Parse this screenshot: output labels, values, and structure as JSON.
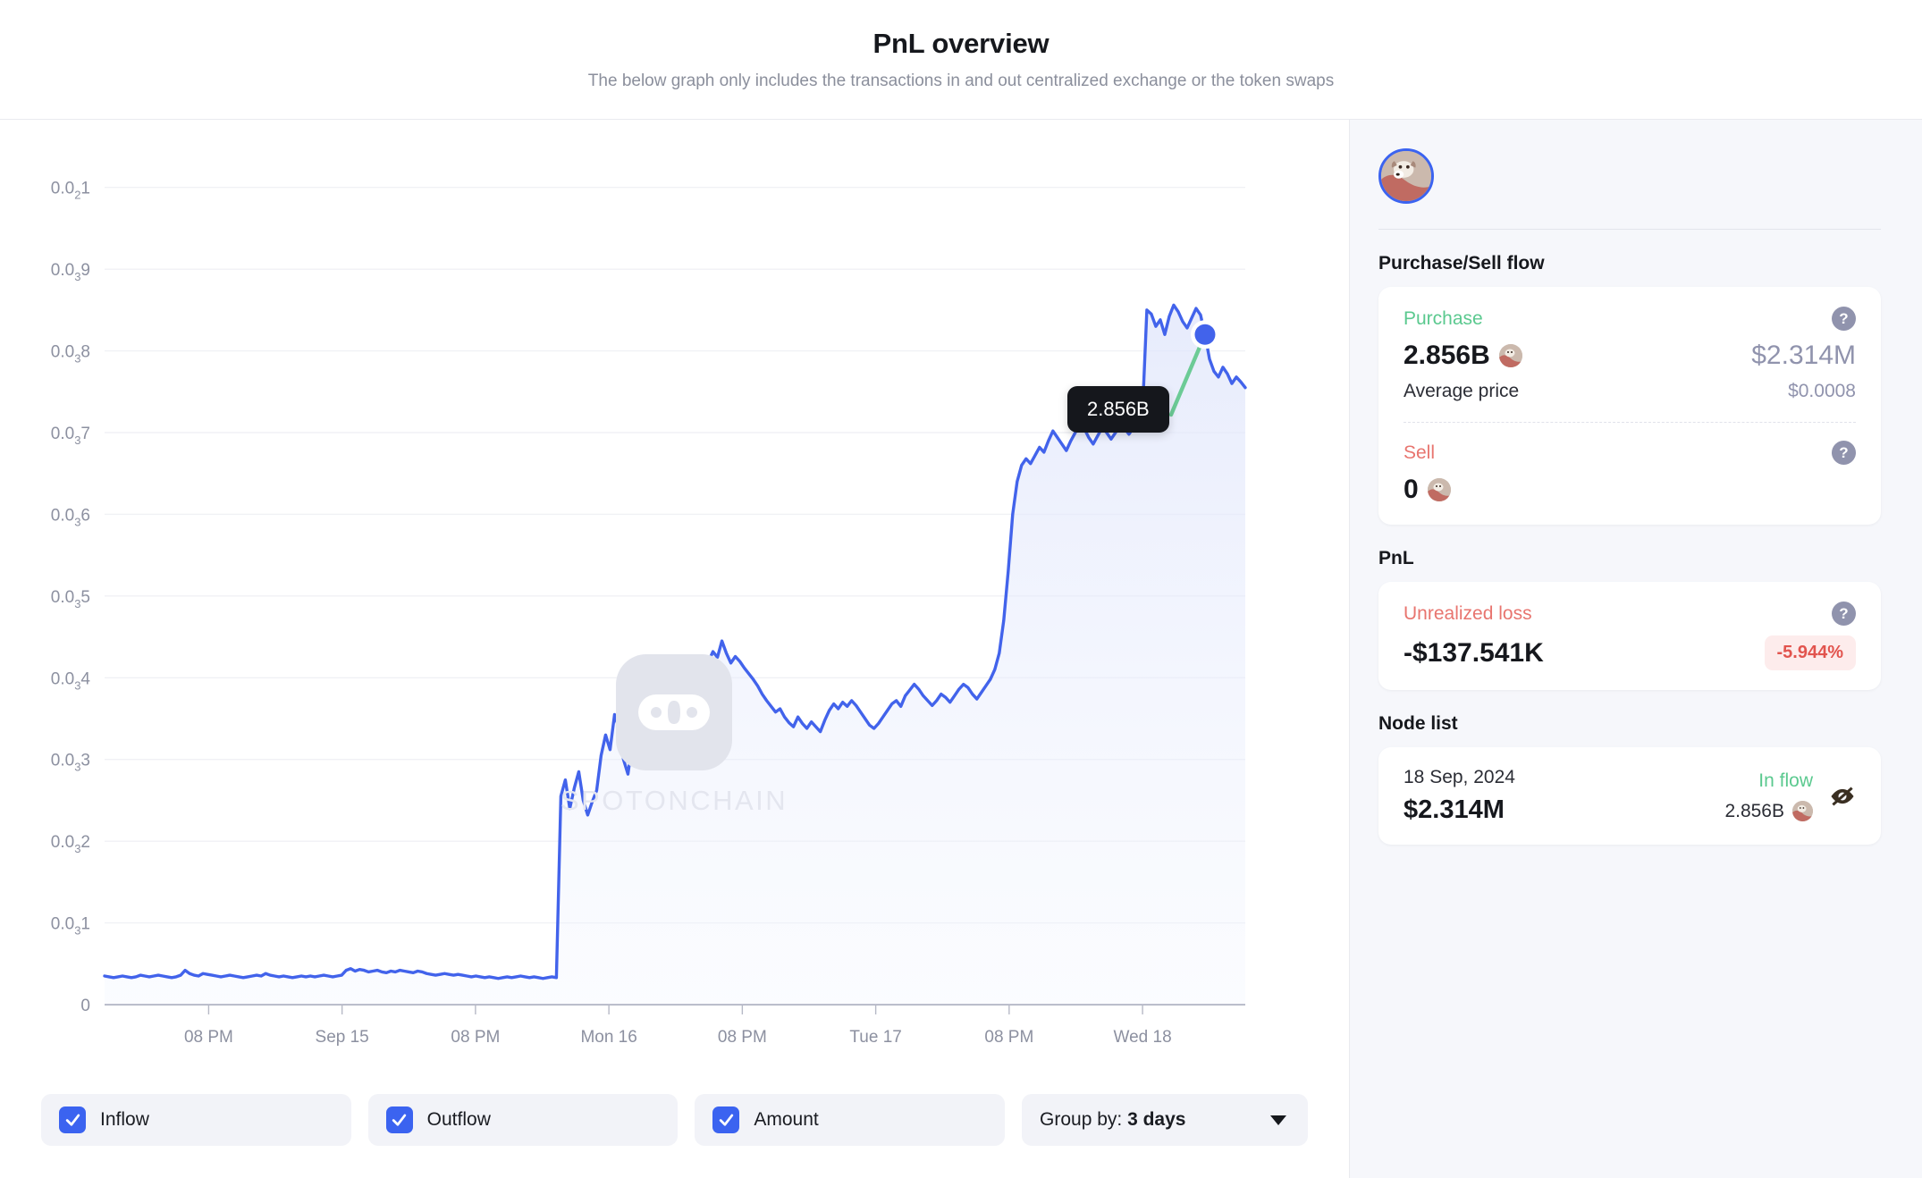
{
  "header": {
    "title": "PnL overview",
    "subtitle": "The below graph only includes the transactions in and out centralized exchange or the token swaps"
  },
  "watermark": {
    "text": "SPOTONCHAIN",
    "logo_icon": "chain-link-icon"
  },
  "chart_tooltip": {
    "value": "2.856B"
  },
  "controls": {
    "inflow": {
      "label": "Inflow",
      "checked": true
    },
    "outflow": {
      "label": "Outflow",
      "checked": true
    },
    "amount": {
      "label": "Amount",
      "checked": true
    },
    "group_by": {
      "prefix": "Group by:",
      "value": "3 days",
      "icon": "chevron-down-icon"
    }
  },
  "sidebar": {
    "avatar_icon": "dog-avatar",
    "purchase_sell": {
      "section_title": "Purchase/Sell flow",
      "purchase": {
        "label": "Purchase",
        "amount": "2.856B",
        "usd": "$2.314M",
        "help_icon": "question-mark-icon",
        "avg_price_label": "Average price",
        "avg_price_value": "$0.0008"
      },
      "sell": {
        "label": "Sell",
        "amount": "0",
        "help_icon": "question-mark-icon"
      }
    },
    "pnl": {
      "section_title": "PnL",
      "label": "Unrealized loss",
      "value": "-$137.541K",
      "percent": "-5.944%",
      "help_icon": "question-mark-icon"
    },
    "node_list": {
      "section_title": "Node list",
      "items": [
        {
          "date": "18 Sep, 2024",
          "usd": "$2.314M",
          "flow_label": "In flow",
          "quantity": "2.856B",
          "visibility_icon": "eye-off-icon"
        }
      ]
    }
  },
  "colors": {
    "line": "#4263eb",
    "fill_top": "#dfe5fb",
    "accent": "#3b63f0",
    "green": "#5bc98f",
    "red": "#e8756f",
    "tooltip_bg": "#15171c",
    "connector": "#6ccb96"
  },
  "chart_data": {
    "type": "area",
    "title": "PnL overview",
    "xlabel": "",
    "ylabel": "",
    "grid": true,
    "legend_position": "bottom",
    "ytick_labels": [
      "0.0₂1",
      "0.0₃9",
      "0.0₃8",
      "0.0₃7",
      "0.0₃6",
      "0.0₃5",
      "0.0₃4",
      "0.0₃3",
      "0.0₃2",
      "0.0₃1",
      "0"
    ],
    "ytick_values": [
      0.001,
      0.0009,
      0.0008,
      0.0007,
      0.0006,
      0.0005,
      0.0004,
      0.0003,
      0.0002,
      0.0001,
      0
    ],
    "ylim": [
      0,
      0.00105
    ],
    "xtick_labels": [
      "08 PM",
      "Sep 15",
      "08 PM",
      "Mon 16",
      "08 PM",
      "Tue 17",
      "08 PM",
      "Wed 18"
    ],
    "annotations": [
      {
        "label": "2.856B",
        "type": "node-marker",
        "date": "18 Sep, 2024",
        "flow": "In flow"
      }
    ],
    "series": [
      {
        "name": "Amount",
        "values": [
          3.5e-05,
          3.4e-05,
          3.3e-05,
          3.4e-05,
          3.5e-05,
          3.4e-05,
          3.3e-05,
          3.4e-05,
          3.6e-05,
          3.5e-05,
          3.4e-05,
          3.5e-05,
          3.6e-05,
          3.5e-05,
          3.4e-05,
          3.3e-05,
          3.4e-05,
          3.6e-05,
          4.2e-05,
          3.8e-05,
          3.6e-05,
          3.5e-05,
          3.8e-05,
          3.7e-05,
          3.6e-05,
          3.5e-05,
          3.4e-05,
          3.5e-05,
          3.6e-05,
          3.5e-05,
          3.4e-05,
          3.3e-05,
          3.4e-05,
          3.5e-05,
          3.6e-05,
          3.5e-05,
          3.8e-05,
          3.6e-05,
          3.5e-05,
          3.4e-05,
          3.5e-05,
          3.4e-05,
          3.3e-05,
          3.4e-05,
          3.5e-05,
          3.4e-05,
          3.5e-05,
          3.4e-05,
          3.5e-05,
          3.6e-05,
          3.5e-05,
          3.4e-05,
          3.5e-05,
          3.6e-05,
          4.2e-05,
          4.4e-05,
          4.1e-05,
          4.3e-05,
          4.2e-05,
          4e-05,
          4.1e-05,
          4.2e-05,
          4e-05,
          3.9e-05,
          4.1e-05,
          4e-05,
          4.2e-05,
          4.1e-05,
          4e-05,
          3.9e-05,
          4.1e-05,
          4e-05,
          3.8e-05,
          3.7e-05,
          3.6e-05,
          3.7e-05,
          3.8e-05,
          3.7e-05,
          3.6e-05,
          3.7e-05,
          3.6e-05,
          3.5e-05,
          3.4e-05,
          3.5e-05,
          3.4e-05,
          3.3e-05,
          3.4e-05,
          3.3e-05,
          3.2e-05,
          3.3e-05,
          3.4e-05,
          3.3e-05,
          3.4e-05,
          3.5e-05,
          3.4e-05,
          3.3e-05,
          3.4e-05,
          3.3e-05,
          3.2e-05,
          3.3e-05,
          3.4e-05,
          3.3e-05,
          0.000255,
          0.000275,
          0.00024,
          0.000265,
          0.000285,
          0.00025,
          0.000232,
          0.000248,
          0.000262,
          0.000305,
          0.00033,
          0.000312,
          0.000355,
          0.000338,
          0.0003,
          0.000282,
          0.000322,
          0.000345,
          0.000352,
          0.000318,
          0.00034,
          0.000362,
          0.000342,
          0.000326,
          0.00031,
          0.000318,
          0.00033,
          0.000325,
          0.000405,
          0.000418,
          0.000402,
          0.000412,
          0.000408,
          0.00042,
          0.000432,
          0.000425,
          0.000445,
          0.00043,
          0.000418,
          0.000426,
          0.00042,
          0.000412,
          0.000405,
          0.000398,
          0.00039,
          0.00038,
          0.000372,
          0.000365,
          0.000358,
          0.000362,
          0.000352,
          0.000345,
          0.00034,
          0.000352,
          0.000344,
          0.000338,
          0.000346,
          0.00034,
          0.000334,
          0.000348,
          0.00036,
          0.000368,
          0.000362,
          0.00037,
          0.000365,
          0.000372,
          0.000366,
          0.000358,
          0.00035,
          0.000342,
          0.000338,
          0.000344,
          0.000352,
          0.00036,
          0.000368,
          0.000372,
          0.000365,
          0.000378,
          0.000385,
          0.000392,
          0.000386,
          0.000378,
          0.000372,
          0.000366,
          0.000372,
          0.00038,
          0.000376,
          0.00037,
          0.000378,
          0.000386,
          0.000392,
          0.000388,
          0.00038,
          0.000374,
          0.000382,
          0.00039,
          0.000398,
          0.00041,
          0.00043,
          0.00047,
          0.00053,
          0.0006,
          0.00064,
          0.00066,
          0.000668,
          0.000662,
          0.000672,
          0.000682,
          0.000676,
          0.00069,
          0.000702,
          0.000694,
          0.000686,
          0.000678,
          0.00069,
          0.0007,
          0.000712,
          0.000705,
          0.000694,
          0.000686,
          0.000696,
          0.000706,
          0.0007,
          0.000692,
          0.0007,
          0.000712,
          0.000705,
          0.000698,
          0.000706,
          0.000716,
          0.000722,
          0.00085,
          0.000845,
          0.00083,
          0.000838,
          0.00082,
          0.000842,
          0.000856,
          0.000848,
          0.000836,
          0.000828,
          0.00084,
          0.000852,
          0.000844,
          0.00082,
          0.00079,
          0.000775,
          0.000768,
          0.00078,
          0.000772,
          0.00076,
          0.000768,
          0.000762,
          0.000755
        ]
      }
    ]
  }
}
